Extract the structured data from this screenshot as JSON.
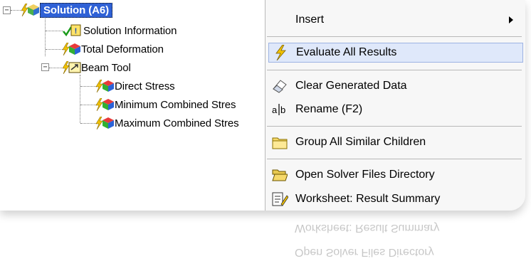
{
  "tree": {
    "root_label": "Solution (A6)",
    "children": [
      {
        "label": "Solution Information"
      },
      {
        "label": "Total Deformation"
      },
      {
        "label": "Beam Tool"
      }
    ],
    "beam_children": [
      {
        "label": "Direct Stress"
      },
      {
        "label": "Minimum Combined Stres"
      },
      {
        "label": "Maximum Combined Stres"
      }
    ]
  },
  "menu": {
    "items": [
      {
        "label": "Insert",
        "icon": "none",
        "submenu": true
      },
      {
        "label": "Evaluate All Results",
        "icon": "lightning-icon"
      },
      {
        "label": "Clear Generated Data",
        "icon": "eraser-icon"
      },
      {
        "label": "Rename (F2)",
        "icon": "rename-icon"
      },
      {
        "label": "Group All Similar Children",
        "icon": "folder-icon"
      },
      {
        "label": "Open Solver Files Directory",
        "icon": "open-folder-icon"
      },
      {
        "label": "Worksheet: Result Summary",
        "icon": "worksheet-icon"
      }
    ]
  },
  "reflection": {
    "row1": "Worksheet: Result Summary",
    "row2": "Open Solver Files Directory"
  },
  "colors": {
    "selection": "#2f61d6",
    "menu_bg": "#f7f7f7",
    "highlight": "#dfe8fa",
    "bolt": "#f2c200"
  }
}
